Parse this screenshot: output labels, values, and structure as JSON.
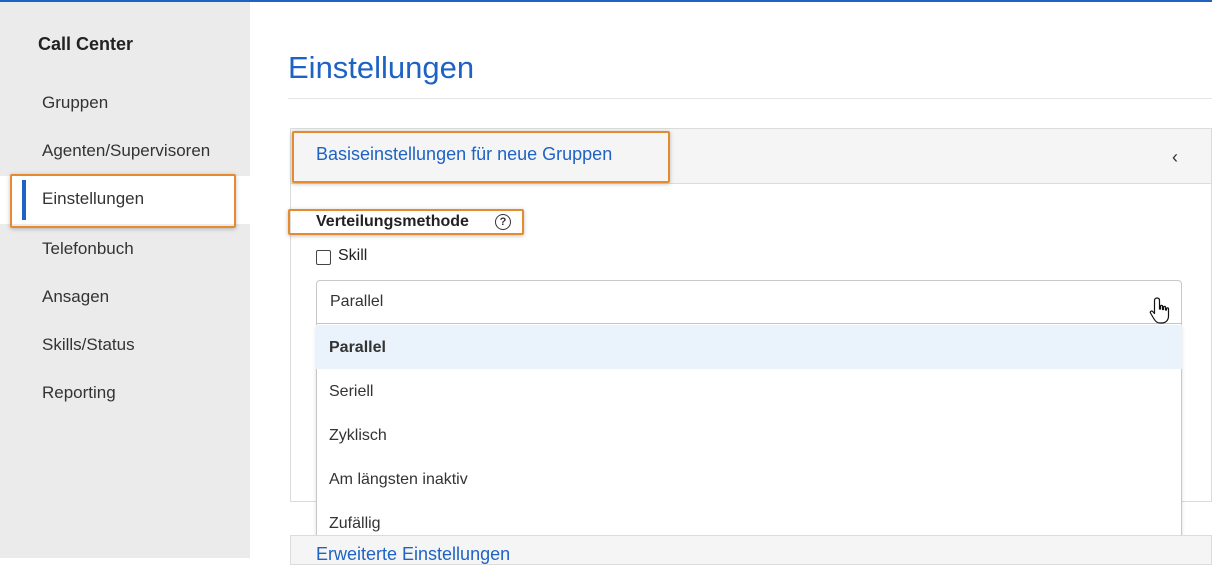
{
  "sidebar": {
    "title": "Call Center",
    "items": [
      {
        "label": "Gruppen"
      },
      {
        "label": "Agenten/Supervisoren"
      },
      {
        "label": "Einstellungen",
        "active": true
      },
      {
        "label": "Telefonbuch"
      },
      {
        "label": "Ansagen"
      },
      {
        "label": "Skills/Status"
      },
      {
        "label": "Reporting"
      }
    ]
  },
  "main": {
    "title": "Einstellungen",
    "panel": {
      "header": "Basiseinstellungen für neue Gruppen",
      "collapse_icon": "chevron-left-icon",
      "distribution_label": "Verteilungsmethode",
      "help_icon": "help-circle-icon",
      "skill_checkbox_label": "Skill",
      "skill_checked": false,
      "select_value": "Parallel",
      "options": [
        "Parallel",
        "Seriell",
        "Zyklisch",
        "Am längsten inaktiv",
        "Zufällig"
      ],
      "selected_option": "Parallel"
    },
    "panel2": {
      "header": "Erweiterte Einstellungen"
    }
  },
  "colors": {
    "accent": "#1e63c4",
    "highlight": "#e68a2e",
    "sidebar_bg": "#ebebeb",
    "selected_option_bg": "#eaf2fb"
  }
}
